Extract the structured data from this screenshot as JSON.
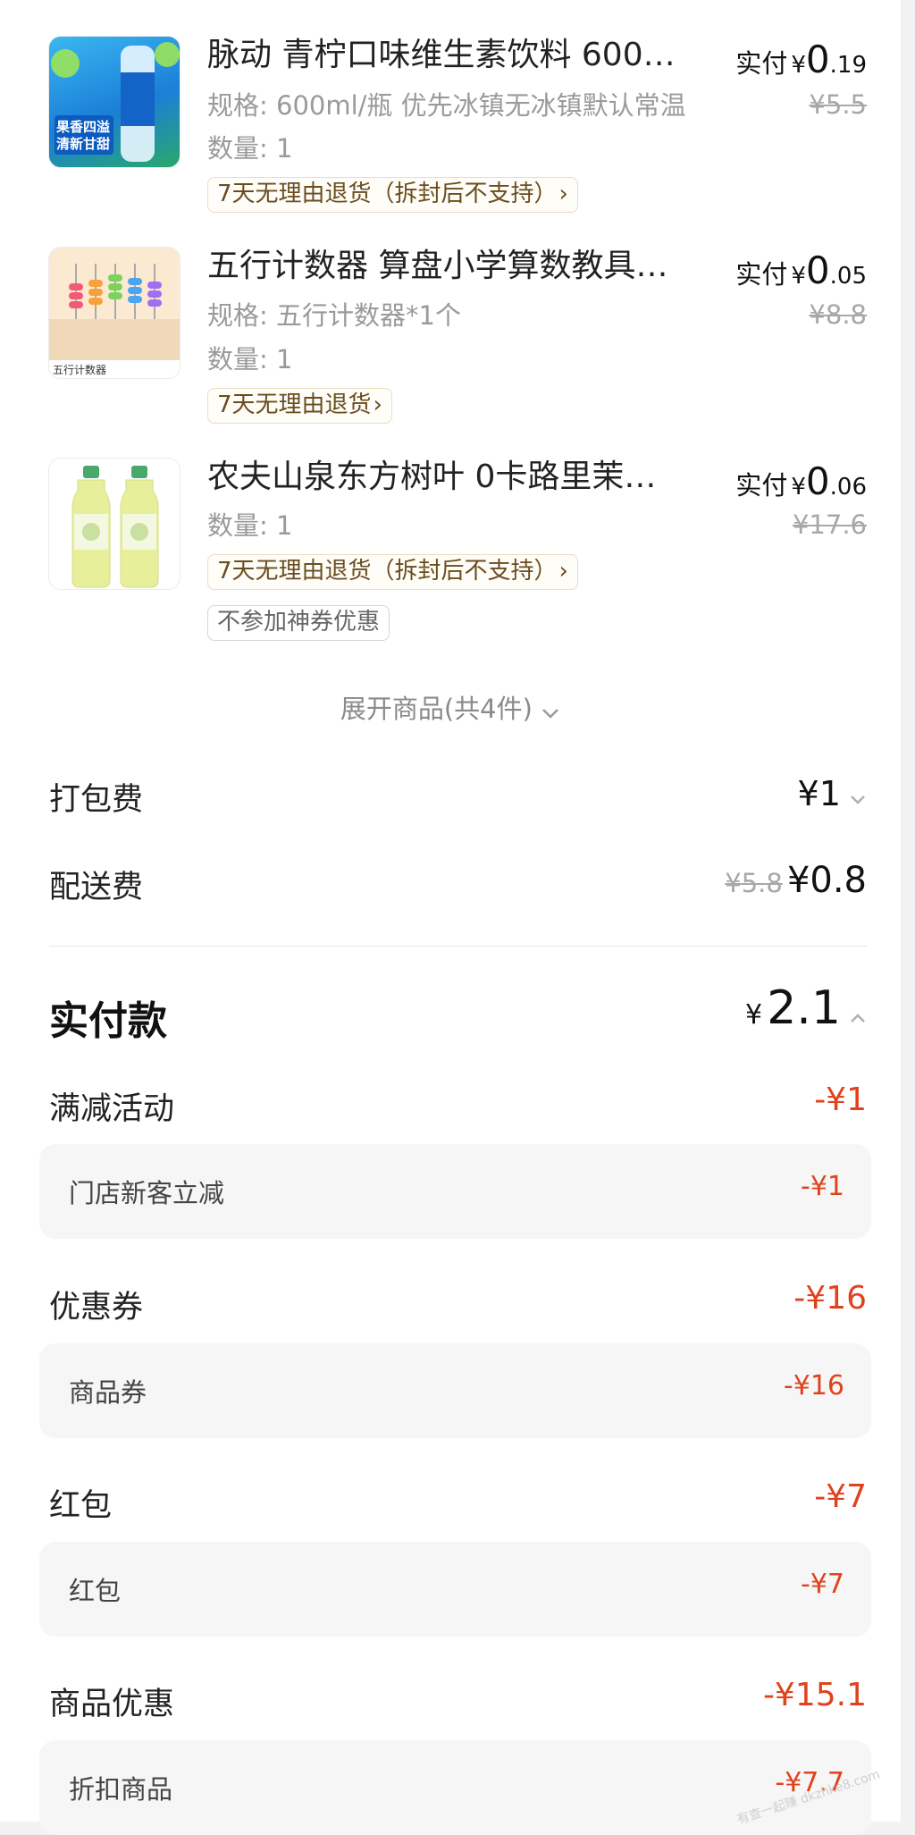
{
  "products": [
    {
      "title": "脉动 青柠口味维生素饮料 600…",
      "spec": "规格: 600ml/瓶 优先冰镇无冰镇默认常温",
      "qty": "数量: 1",
      "tag": "7天无理由退货（拆封后不支持）",
      "paid_label": "实付",
      "paid_yen": "¥",
      "paid_int": "0",
      "paid_dec": ".19",
      "orig_price": "¥5.5",
      "thumb_text": "果香四溢 清新甘甜"
    },
    {
      "title": "五行计数器 算盘小学算数教具…",
      "spec": "规格: 五行计数器*1个",
      "qty": "数量: 1",
      "tag": "7天无理由退货",
      "paid_label": "实付",
      "paid_yen": "¥",
      "paid_int": "0",
      "paid_dec": ".05",
      "orig_price": "¥8.8",
      "thumb_text": "五行计数器"
    },
    {
      "title": "农夫山泉东方树叶 0卡路里茉…",
      "qty": "数量: 1",
      "tag": "7天无理由退货（拆封后不支持）",
      "tag2": "不参加神券优惠",
      "paid_label": "实付",
      "paid_yen": "¥",
      "paid_int": "0",
      "paid_dec": ".06",
      "orig_price": "¥17.6"
    }
  ],
  "expand_label": "展开商品(共4件)",
  "fees": {
    "packing_label": "打包费",
    "packing_value": "¥1",
    "delivery_label": "配送费",
    "delivery_orig": "¥5.8",
    "delivery_value": "¥0.8"
  },
  "total": {
    "label": "实付款",
    "yen": "¥",
    "value": "2.1"
  },
  "discounts": [
    {
      "label": "满减活动",
      "value": "-¥1",
      "sub_label": "门店新客立减",
      "sub_value": "-¥1"
    },
    {
      "label": "优惠券",
      "value": "-¥16",
      "sub_label": "商品券",
      "sub_value": "-¥16"
    },
    {
      "label": "红包",
      "value": "-¥7",
      "sub_label": "红包",
      "sub_value": "-¥7"
    },
    {
      "label": "商品优惠",
      "value": "-¥15.1",
      "sub_label": "折扣商品",
      "sub_value": "-¥7.7"
    }
  ],
  "watermark": "有查一起赚 dkzhke8.com",
  "colors": {
    "discount_red": "#e0421e",
    "tag_border": "#eadcc0",
    "tag_text": "#6a4d1f"
  }
}
